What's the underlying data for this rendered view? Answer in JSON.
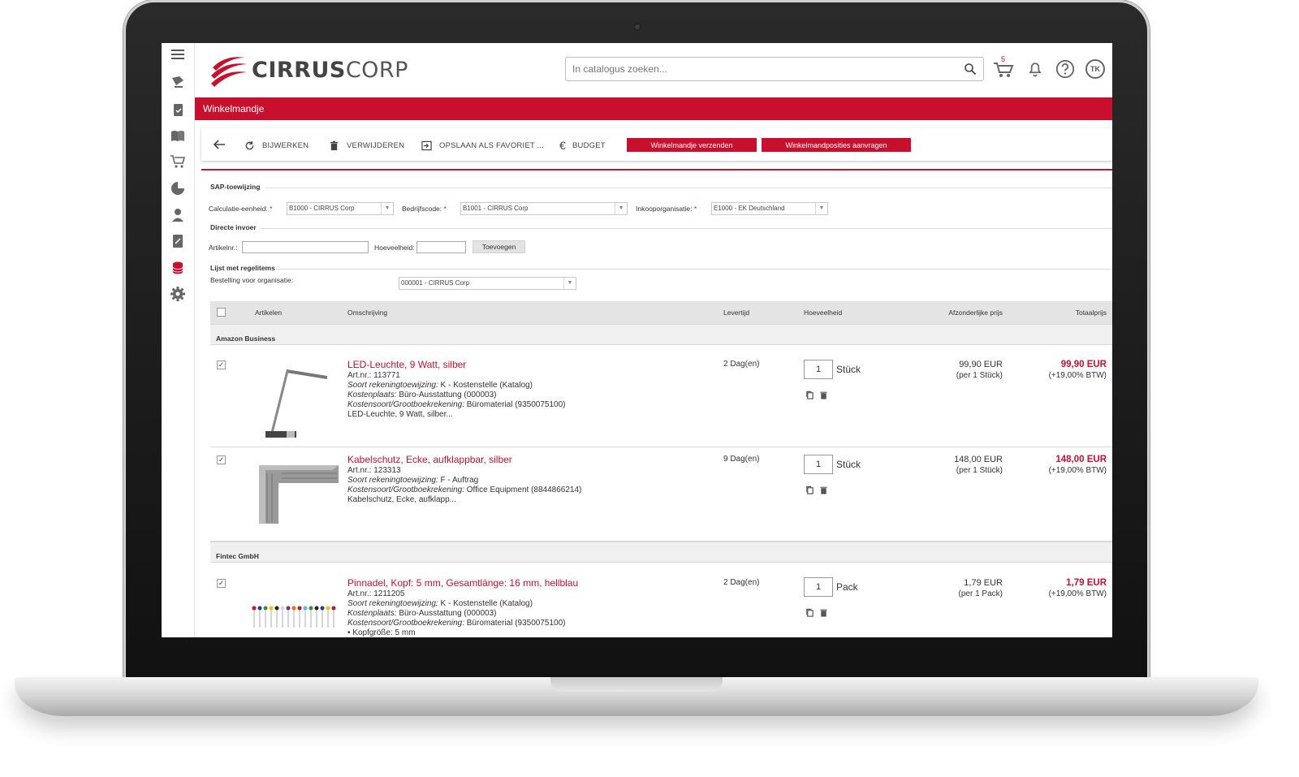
{
  "app": {
    "brand_bold": "CIRRUS",
    "brand_light": "CORP",
    "page_title": "Winkelmandje",
    "brand_color": "#c8102e"
  },
  "header": {
    "search_placeholder": "In catalogus zoeken...",
    "cart_count": "5",
    "user_initials": "TK",
    "icons": [
      "search-icon",
      "cart-icon",
      "bell-icon",
      "help-icon",
      "avatar"
    ]
  },
  "sidebar": {
    "icons": [
      "menu-icon",
      "catalog-icon",
      "clipboard-icon",
      "book-icon",
      "cart-icon",
      "pie-chart-icon",
      "user-icon",
      "edit-icon",
      "database-icon",
      "gear-icon"
    ]
  },
  "toolbar": {
    "update": "BIJWERKEN",
    "delete": "VERWIJDEREN",
    "save_favorite": "OPSLAAN ALS FAVORIET ...",
    "budget": "BUDGET",
    "send_cart": "Winkelmandje verzenden",
    "request_items": "Winkelmandposities aanvragen"
  },
  "sap": {
    "title": "SAP-toewijzing",
    "calc_label": "Calculatie-eenheid:",
    "calc_value": "B1000 - CIRRUS Corp",
    "company_label": "Bedrijfscode:",
    "company_value": "B1001 - CIRRUS Corp",
    "purch_label": "Inkooporganisatie:",
    "purch_value": "E1000 - EK Deutschland",
    "required_mark": "*"
  },
  "direct": {
    "title": "Directe invoer",
    "article_label": "Artikelnr.:",
    "article_value": "",
    "qty_label": "Hoeveelheid:",
    "qty_value": "",
    "add_button": "Toevoegen"
  },
  "list": {
    "title": "Lijst met regelitems",
    "org_label": "Bestelling voor organisatie:",
    "org_value": "000001 - CIRRUS Corp"
  },
  "table": {
    "columns": {
      "articles": "Artikelen",
      "description": "Omschrijving",
      "lead": "Levertijd",
      "quantity": "Hoeveelheid",
      "unit_price": "Afzonderlijke prijs",
      "total": "Totaalprijs"
    },
    "groups": [
      {
        "name": "Amazon Business",
        "items": [
          {
            "title": "LED-Leuchte, 9 Watt, silber",
            "art_label": "Art.nr.:",
            "art_no": "113771",
            "lines": [
              {
                "k": "Soort rekeningtoewijzing:",
                "v": " K - Kostenstelle (Katalog)"
              },
              {
                "k": "Kostenplaats:",
                "v": " Büro-Ausstattung (000003)"
              },
              {
                "k": "Kostensoort/Grootboekrekening:",
                "v": " Büromaterial (9350075100)"
              }
            ],
            "summary": "LED-Leuchte, 9 Watt, silber...",
            "lead": "2 Dag(en)",
            "qty": "1",
            "unit": "Stück",
            "unit_price": "99,90 EUR",
            "unit_sub": "(per 1 Stück)",
            "total": "99,90 EUR",
            "total_sub": "(+19,00% BTW)"
          },
          {
            "title": "Kabelschutz, Ecke, aufklappbar, silber",
            "art_label": "Art.nr.:",
            "art_no": "123313",
            "lines": [
              {
                "k": "Soort rekeningtoewijzing:",
                "v": " F - Auftrag"
              },
              {
                "k": "Kostensoort/Grootboekrekening:",
                "v": " Office Equipment (8844866214)"
              }
            ],
            "summary": "Kabelschutz, Ecke, aufklapp...",
            "lead": "9 Dag(en)",
            "qty": "1",
            "unit": "Stück",
            "unit_price": "148,00 EUR",
            "unit_sub": "(per 1 Stück)",
            "total": "148,00 EUR",
            "total_sub": "(+19,00% BTW)"
          }
        ]
      },
      {
        "name": "Fintec GmbH",
        "items": [
          {
            "title": "Pinnadel, Kopf: 5 mm, Gesamtlänge: 16 mm, hellblau",
            "art_label": "Art.nr.:",
            "art_no": "1211205",
            "lines": [
              {
                "k": "Soort rekeningtoewijzing:",
                "v": " K - Kostenstelle (Katalog)"
              },
              {
                "k": "Kostenplaats:",
                "v": " Büro-Ausstattung (000003)"
              },
              {
                "k": "Kostensoort/Grootboekrekening:",
                "v": " Büromaterial (9350075100)"
              }
            ],
            "summary": "• Kopfgröße: 5 mm",
            "lead": "2 Dag(en)",
            "qty": "1",
            "unit": "Pack",
            "unit_price": "1,79 EUR",
            "unit_sub": "(per 1 Pack)",
            "total": "1,79 EUR",
            "total_sub": "(+19,00% BTW)"
          }
        ]
      }
    ]
  }
}
